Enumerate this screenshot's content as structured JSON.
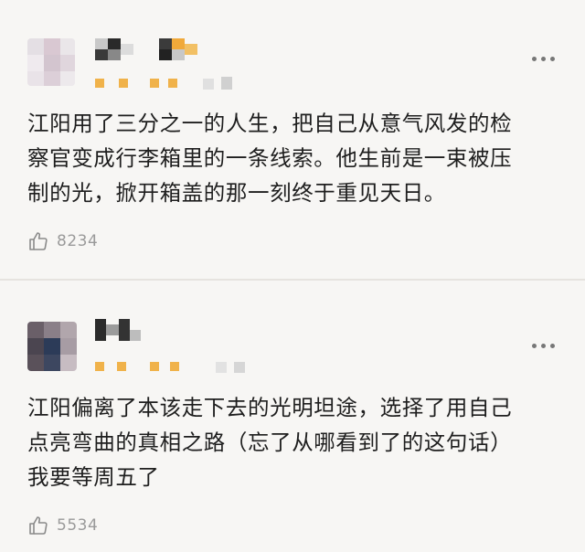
{
  "comments": [
    {
      "text": "江阳用了三分之一的人生，把自己从意气风发的检\n察官变成行李箱里的一条线索。他生前是一束被压\n制的光，掀开箱盖的那一刻终于重见天日。",
      "likes": "8234"
    },
    {
      "text": "江阳偏离了本该走下去的光明坦途，选择了用自己\n点亮弯曲的真相之路（忘了从哪看到了的这句话）\n我要等周五了",
      "likes": "5534"
    }
  ],
  "icons": {
    "like": "thumbs-up-icon",
    "more": "more-options-icon"
  },
  "colors": {
    "background": "#f7f6f4",
    "text": "#1e1e1e",
    "muted": "#9a9a9a",
    "badge": "#f0b24a"
  }
}
